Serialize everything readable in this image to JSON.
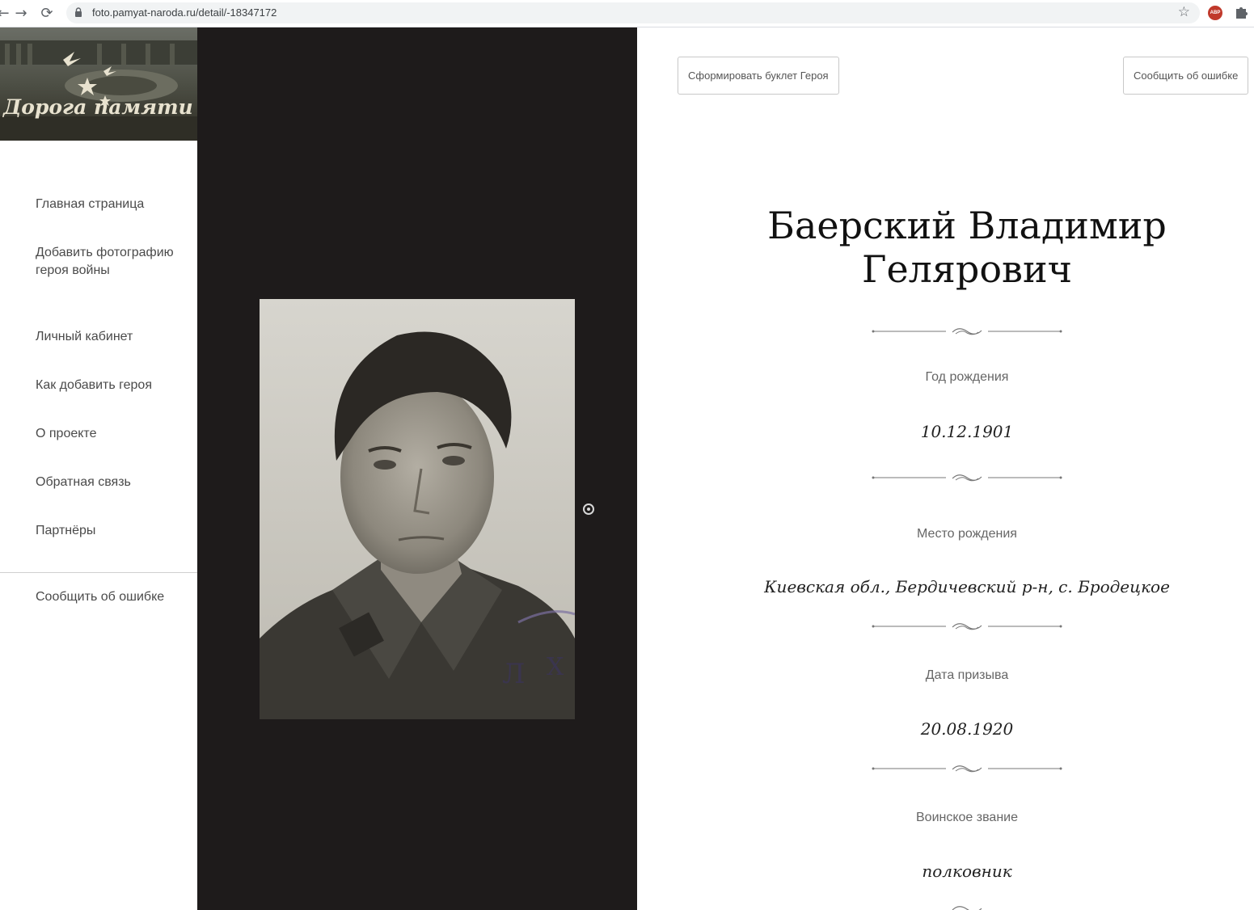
{
  "browser": {
    "url": "foto.pamyat-naroda.ru/detail/-18347172",
    "abp_label": "ABP"
  },
  "sidebar": {
    "logo_text": "Дорога памяти",
    "items": [
      {
        "label": "Главная страница"
      },
      {
        "label": "Добавить фотографию героя войны"
      },
      {
        "label": "Личный кабинет"
      },
      {
        "label": "Как добавить героя"
      },
      {
        "label": "О проекте"
      },
      {
        "label": "Обратная связь"
      },
      {
        "label": "Партнёры"
      }
    ],
    "report_error": "Сообщить об ошибке"
  },
  "toolbar": {
    "booklet_button": "Сформировать буклет Героя",
    "report_button": "Сообщить об ошибке"
  },
  "hero": {
    "name_line1": "Баерский Владимир",
    "name_line2": "Гелярович",
    "fields": [
      {
        "label": "Год рождения",
        "value": "10.12.1901"
      },
      {
        "label": "Место рождения",
        "value": "Киевская обл., Бердичевский р-н, с. Бродецкое"
      },
      {
        "label": "Дата призыва",
        "value": "20.08.1920"
      },
      {
        "label": "Воинское звание",
        "value": "полковник"
      }
    ]
  }
}
